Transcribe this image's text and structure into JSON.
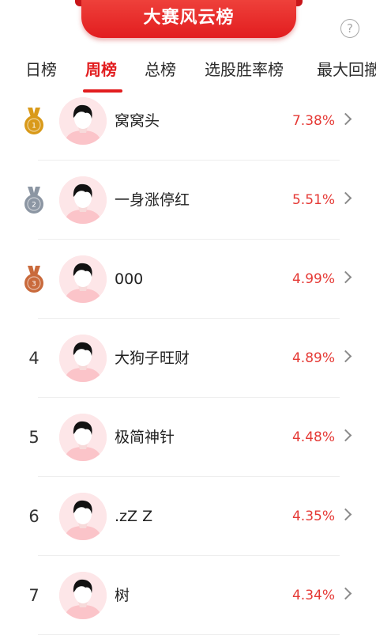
{
  "header": {
    "title": "大赛风云榜",
    "help_symbol": "?"
  },
  "tabs": [
    {
      "label": "日榜"
    },
    {
      "label": "周榜"
    },
    {
      "label": "总榜"
    },
    {
      "label": "选股胜率榜"
    },
    {
      "label": "最大回撤"
    }
  ],
  "active_tab": "周榜",
  "colors": {
    "accent": "#e21d1f",
    "gold": "#d99a1a",
    "silver": "#8c96a3",
    "bronze": "#c96a3c",
    "percent": "#e53935"
  },
  "rows": [
    {
      "rank": "1",
      "medal": "gold",
      "name": "窝窝头",
      "percent": "7.38%"
    },
    {
      "rank": "2",
      "medal": "silver",
      "name": "一身涨停红",
      "percent": "5.51%"
    },
    {
      "rank": "3",
      "medal": "bronze",
      "name": "000",
      "percent": "4.99%"
    },
    {
      "rank": "4",
      "medal": null,
      "name": "大狗子旺财",
      "percent": "4.89%"
    },
    {
      "rank": "5",
      "medal": null,
      "name": "极简神针",
      "percent": "4.48%"
    },
    {
      "rank": "6",
      "medal": null,
      "name": ".zZ Z",
      "percent": "4.35%"
    },
    {
      "rank": "7",
      "medal": null,
      "name": "树",
      "percent": "4.34%"
    }
  ]
}
